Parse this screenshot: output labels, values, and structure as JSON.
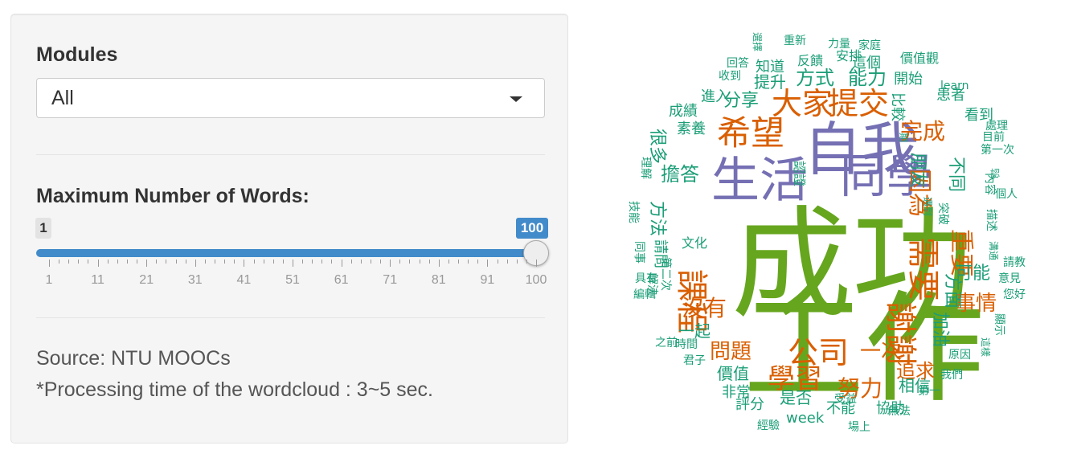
{
  "sidebar": {
    "modules_label": "Modules",
    "modules_value": "All",
    "max_words_label": "Maximum Number of Words:",
    "slider": {
      "min": 1,
      "max": 100,
      "value": 100,
      "min_badge": "1",
      "max_badge": "100",
      "tick_labels": [
        "1",
        "11",
        "21",
        "31",
        "41",
        "51",
        "61",
        "71",
        "81",
        "91",
        "100"
      ]
    },
    "source_text": "Source: NTU MOOCs",
    "note_text": "*Processing time of the wordcloud : 3~5 sec."
  },
  "colors": {
    "accent": "#428bca",
    "green": "#1b9e77",
    "orange": "#d95f02",
    "purple": "#7570b3",
    "lime": "#66a61e"
  },
  "wordcloud": {
    "words": [
      {
        "text": "成功",
        "color": "lime"
      },
      {
        "text": "工作",
        "color": "lime"
      },
      {
        "text": "自我",
        "color": "purple"
      },
      {
        "text": "生活",
        "color": "purple"
      },
      {
        "text": "同學",
        "color": "purple"
      },
      {
        "text": "課程",
        "color": "orange"
      },
      {
        "text": "希望",
        "color": "orange"
      },
      {
        "text": "大家",
        "color": "orange"
      },
      {
        "text": "提交",
        "color": "orange"
      },
      {
        "text": "需要",
        "color": "orange"
      },
      {
        "text": "謝謝",
        "color": "orange"
      },
      {
        "text": "公司",
        "color": "orange"
      },
      {
        "text": "學習",
        "color": "orange"
      },
      {
        "text": "完成",
        "color": "orange"
      },
      {
        "text": "因為",
        "color": "orange"
      },
      {
        "text": "沒有",
        "color": "orange"
      },
      {
        "text": "問題",
        "color": "orange"
      },
      {
        "text": "事情",
        "color": "orange"
      },
      {
        "text": "努力",
        "color": "orange"
      },
      {
        "text": "一次",
        "color": "orange"
      },
      {
        "text": "追求",
        "color": "orange"
      },
      {
        "text": "重要",
        "color": "orange"
      },
      {
        "text": "擔答",
        "color": "green"
      },
      {
        "text": "方法",
        "color": "green"
      },
      {
        "text": "朋友",
        "color": "green"
      },
      {
        "text": "不同",
        "color": "green"
      },
      {
        "text": "能力",
        "color": "green"
      },
      {
        "text": "方式",
        "color": "green"
      },
      {
        "text": "分享",
        "color": "green"
      },
      {
        "text": "提升",
        "color": "green"
      },
      {
        "text": "很多",
        "color": "green"
      },
      {
        "text": "可能",
        "color": "green"
      },
      {
        "text": "加油",
        "color": "green"
      },
      {
        "text": "方面",
        "color": "green"
      },
      {
        "text": "相信",
        "color": "green"
      },
      {
        "text": "價值",
        "color": "green"
      },
      {
        "text": "一起",
        "color": "green"
      },
      {
        "text": "是否",
        "color": "green"
      },
      {
        "text": "不能",
        "color": "green"
      },
      {
        "text": "協助",
        "color": "green"
      },
      {
        "text": "week",
        "color": "green"
      },
      {
        "text": "非常",
        "color": "green"
      },
      {
        "text": "評分",
        "color": "green"
      },
      {
        "text": "請問",
        "color": "green"
      },
      {
        "text": "知道",
        "color": "green"
      },
      {
        "text": "這個",
        "color": "green"
      },
      {
        "text": "開始",
        "color": "green"
      },
      {
        "text": "比較",
        "color": "green"
      },
      {
        "text": "進入",
        "color": "green"
      },
      {
        "text": "素養",
        "color": "green"
      },
      {
        "text": "成績",
        "color": "green"
      },
      {
        "text": "看到",
        "color": "green"
      },
      {
        "text": "患者",
        "color": "green"
      },
      {
        "text": "learn",
        "color": "green"
      },
      {
        "text": "價值觀",
        "color": "green"
      },
      {
        "text": "家庭",
        "color": "green"
      },
      {
        "text": "力量",
        "color": "green"
      },
      {
        "text": "安排",
        "color": "green"
      },
      {
        "text": "反饋",
        "color": "green"
      },
      {
        "text": "重新",
        "color": "green"
      },
      {
        "text": "選擇",
        "color": "green"
      },
      {
        "text": "回答",
        "color": "green"
      },
      {
        "text": "收到",
        "color": "green"
      },
      {
        "text": "處理",
        "color": "green"
      },
      {
        "text": "目前",
        "color": "green"
      },
      {
        "text": "第一次",
        "color": "green"
      },
      {
        "text": "內容",
        "color": "green"
      },
      {
        "text": "個人",
        "color": "green"
      },
      {
        "text": "認",
        "color": "green"
      },
      {
        "text": "描述",
        "color": "green"
      },
      {
        "text": "溝通",
        "color": "green"
      },
      {
        "text": "請教",
        "color": "green"
      },
      {
        "text": "意見",
        "color": "green"
      },
      {
        "text": "您好",
        "color": "green"
      },
      {
        "text": "顯示",
        "color": "green"
      },
      {
        "text": "這樣",
        "color": "green"
      },
      {
        "text": "原因",
        "color": "green"
      },
      {
        "text": "我們",
        "color": "green"
      },
      {
        "text": "第一",
        "color": "green"
      },
      {
        "text": "無法",
        "color": "green"
      },
      {
        "text": "場上",
        "color": "green"
      },
      {
        "text": "受益",
        "color": "green"
      },
      {
        "text": "經驗",
        "color": "green"
      },
      {
        "text": "君子",
        "color": "green"
      },
      {
        "text": "時間",
        "color": "green"
      },
      {
        "text": "之前",
        "color": "green"
      },
      {
        "text": "編輯",
        "color": "green"
      },
      {
        "text": "具有",
        "color": "green"
      },
      {
        "text": "解決",
        "color": "green"
      },
      {
        "text": "同事",
        "color": "green"
      },
      {
        "text": "技能",
        "color": "green"
      },
      {
        "text": "理解",
        "color": "green"
      },
      {
        "text": "認證",
        "color": "green"
      },
      {
        "text": "期",
        "color": "green"
      },
      {
        "text": "遇到",
        "color": "green"
      },
      {
        "text": "突破",
        "color": "green"
      },
      {
        "text": "第二次",
        "color": "green"
      },
      {
        "text": "文化",
        "color": "green"
      },
      {
        "text": "提供",
        "color": "green"
      },
      {
        "text": "幫助",
        "color": "green"
      }
    ]
  }
}
